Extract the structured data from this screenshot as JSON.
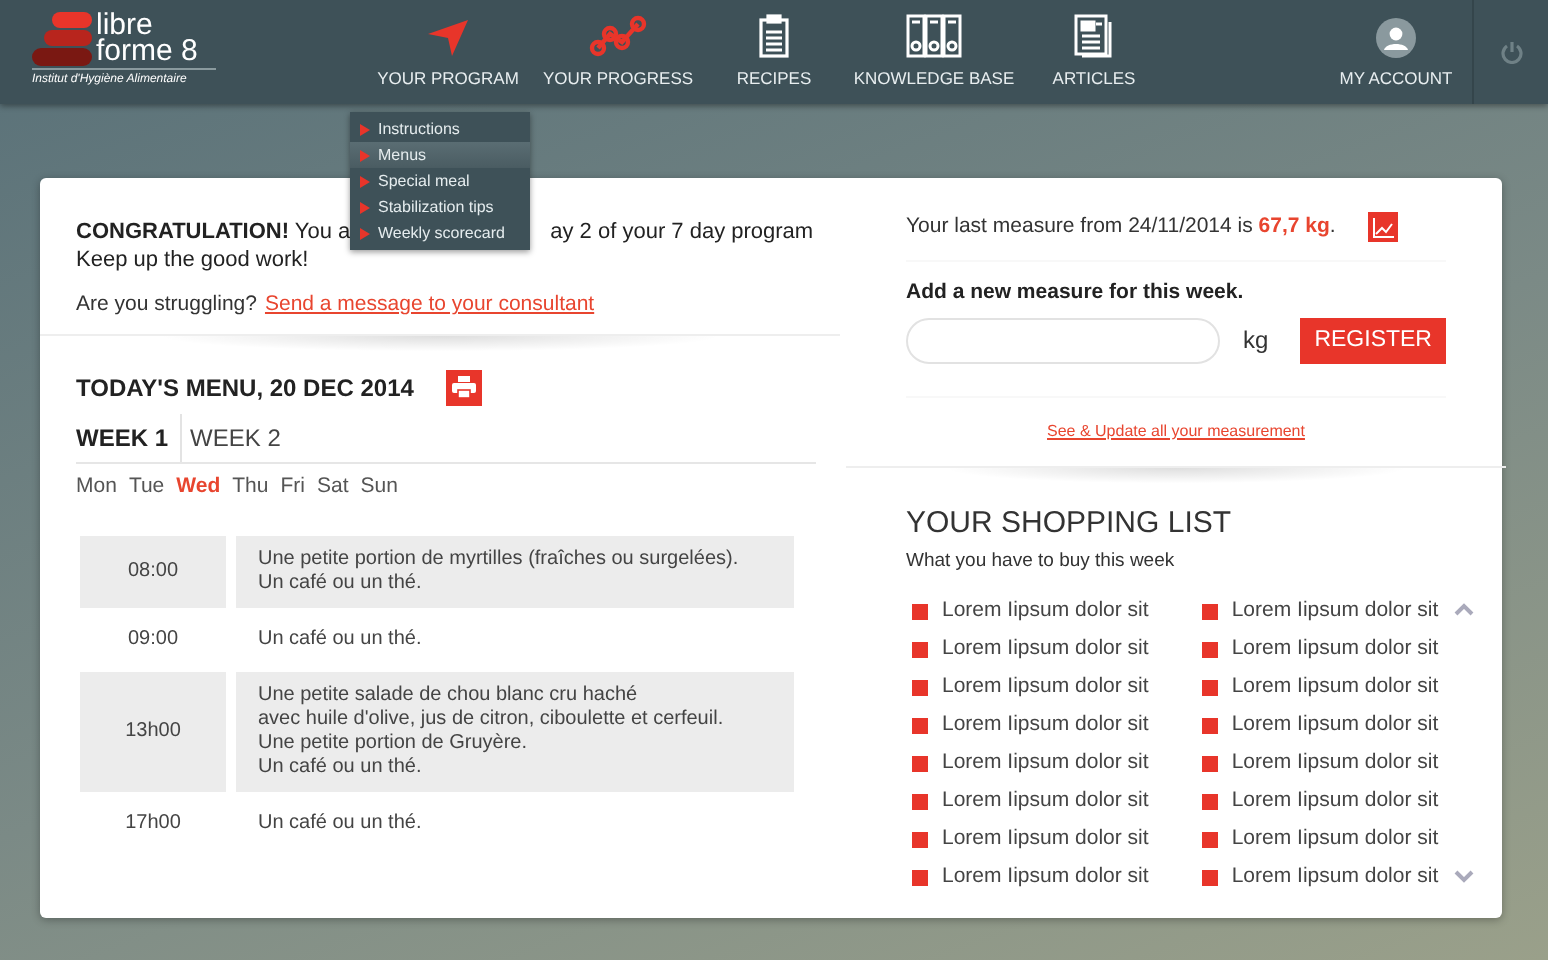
{
  "header": {
    "logo": {
      "line1": "libre",
      "line2": "forme 8",
      "tagline": "Institut d'Hygiène Alimentaire"
    },
    "nav": [
      {
        "label": "YOUR PROGRAM",
        "kind": "plane",
        "highlighted": true
      },
      {
        "label": "YOUR PROGRESS",
        "kind": "graph",
        "highlighted": true
      },
      {
        "label": "RECIPES",
        "kind": "clipboard",
        "highlighted": false
      },
      {
        "label": "KNOWLEDGE BASE",
        "kind": "binders",
        "highlighted": false
      },
      {
        "label": "ARTICLES",
        "kind": "document",
        "highlighted": false
      }
    ],
    "account": {
      "label": "MY ACCOUNT"
    }
  },
  "program_menu": [
    {
      "label": "Instructions",
      "selected": false
    },
    {
      "label": "Menus",
      "selected": true
    },
    {
      "label": "Special meal",
      "selected": false
    },
    {
      "label": "Stabilization tips",
      "selected": false
    },
    {
      "label": "Weekly scorecard",
      "selected": false
    }
  ],
  "congrats": {
    "before": "**CONGRATULATION!** You a",
    "after": "ay 2 of your 7 day program",
    "line2": "Keep up the good work!",
    "question": "Are you struggling?",
    "link": "Send a message to your consultant"
  },
  "menu": {
    "title": "TODAY'S MENU, 20 DEC 2014",
    "weeks": [
      {
        "label": "WEEK 1",
        "selected": true
      },
      {
        "label": "WEEK 2",
        "selected": false
      }
    ],
    "days": [
      {
        "label": "Mon",
        "selected": false
      },
      {
        "label": "Tue",
        "selected": false
      },
      {
        "label": "Wed",
        "selected": true
      },
      {
        "label": "Thu",
        "selected": false
      },
      {
        "label": "Fri",
        "selected": false
      },
      {
        "label": "Sat",
        "selected": false
      },
      {
        "label": "Sun",
        "selected": false
      }
    ],
    "meals": [
      {
        "time": "08:00",
        "lines": [
          "Une petite portion de myrtilles (fraîches ou surgelées).",
          "Un café ou un thé."
        ]
      },
      {
        "time": "09:00",
        "lines": [
          "Un café ou un thé."
        ]
      },
      {
        "time": "13h00",
        "lines": [
          "Une petite salade de chou blanc cru haché",
          "avec huile d'olive, jus de citron, ciboulette et cerfeuil.",
          "Une petite portion de Gruyère.",
          "Un café ou un thé."
        ]
      },
      {
        "time": "17h00",
        "lines": [
          "Un café ou un thé."
        ]
      }
    ]
  },
  "measure": {
    "before": "Your last measure from 24/11/2014 is",
    "value": "67,7 kg",
    "after": ".",
    "add_title": "Add a new measure for this week.",
    "unit": "kg",
    "button": "REGISTER",
    "link": "See & Update all your measurement"
  },
  "shopping": {
    "title": "YOUR SHOPPING LIST",
    "subtitle": "What you have to buy this week",
    "items": [
      "Lorem Iipsum dolor sit",
      "Lorem Iipsum dolor sit",
      "Lorem Iipsum dolor sit",
      "Lorem Iipsum dolor sit",
      "Lorem Iipsum dolor sit",
      "Lorem Iipsum dolor sit",
      "Lorem Iipsum dolor sit",
      "Lorem Iipsum dolor sit",
      "Lorem Iipsum dolor sit",
      "Lorem Iipsum dolor sit",
      "Lorem Iipsum dolor sit",
      "Lorem Iipsum dolor sit",
      "Lorem Iipsum dolor sit",
      "Lorem Iipsum dolor sit",
      "Lorem Iipsum dolor sit",
      "Lorem Iipsum dolor sit"
    ]
  }
}
